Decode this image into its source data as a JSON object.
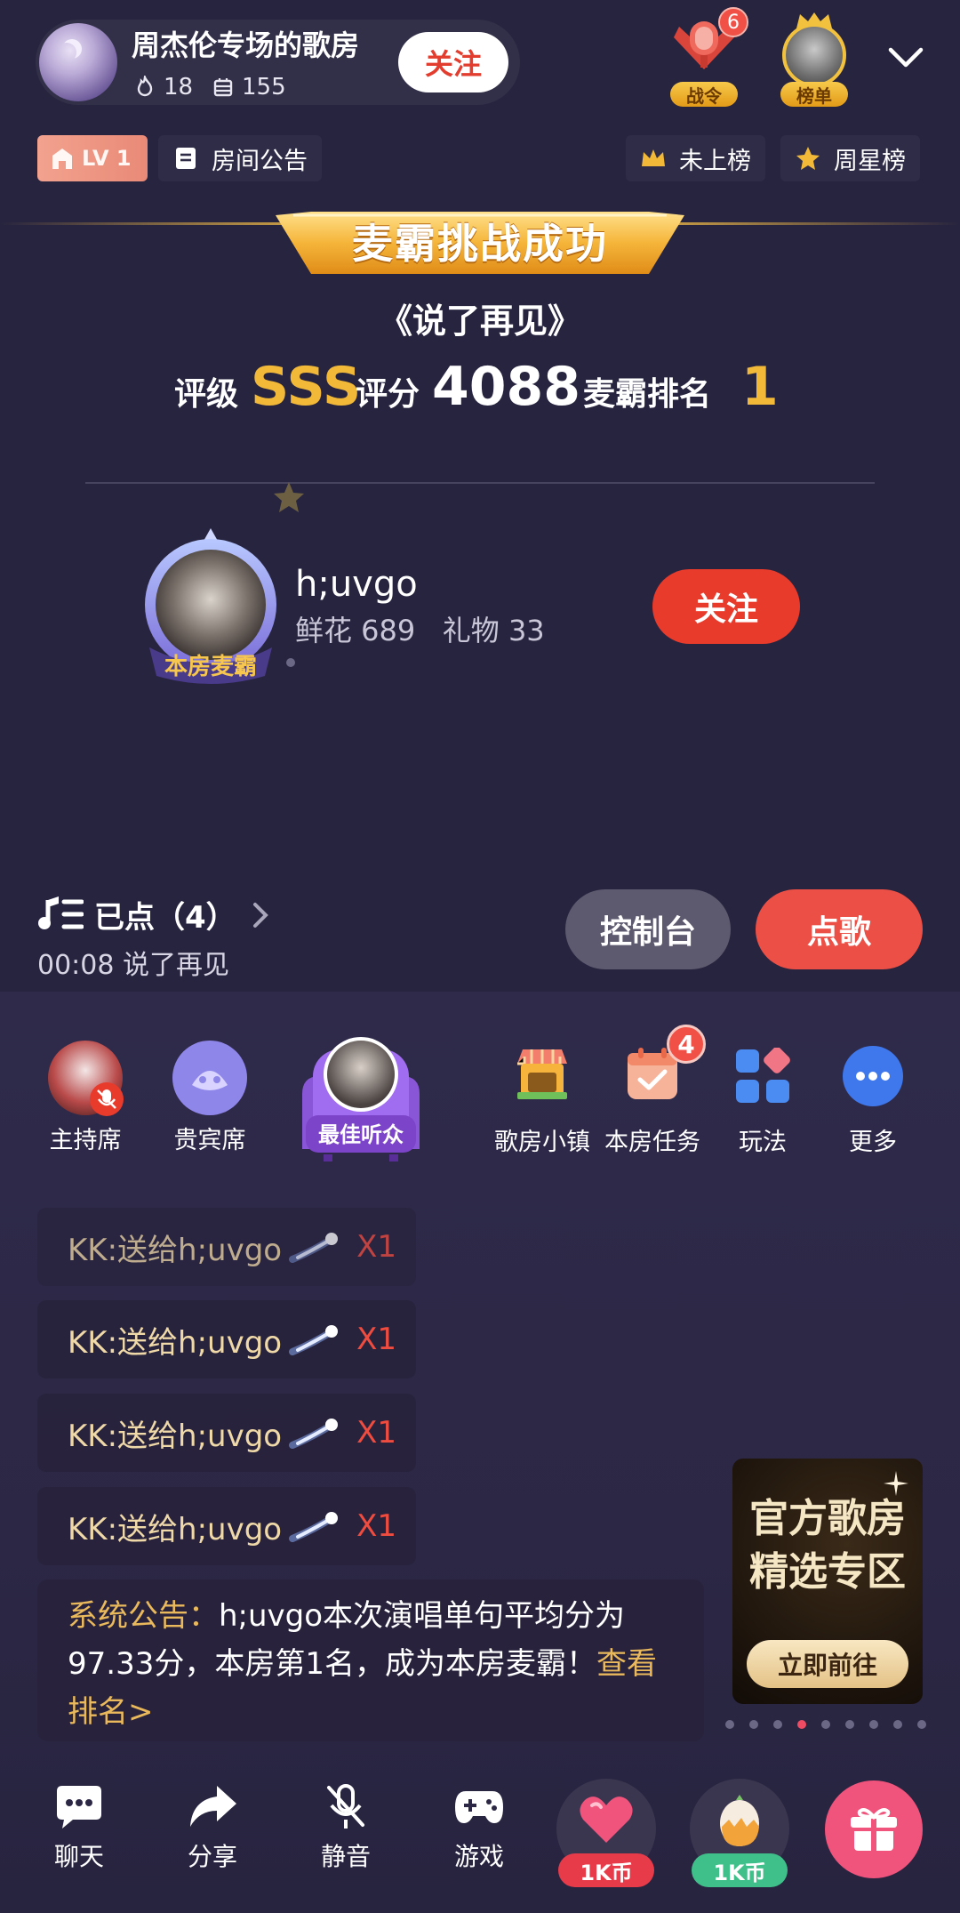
{
  "header": {
    "room_title": "周杰伦专场的歌房",
    "hot_count": "18",
    "member_count": "155",
    "follow_label": "关注",
    "zhanling_label": "战令",
    "zhanling_badge": "6",
    "rank_label": "榜单"
  },
  "room_bar": {
    "level": "LV 1",
    "announcement": "房间公告",
    "not_ranked": "未上榜",
    "weekly_star": "周星榜"
  },
  "challenge": {
    "banner": "麦霸挑战成功",
    "song": "《说了再见》",
    "grade_label": "评级",
    "grade": "SSS",
    "score_label": "评分",
    "score": "4088",
    "rank_label": "麦霸排名",
    "rank": "1",
    "winner_name": "h;uvgo",
    "winner_stats": "鲜花 689   礼物 33",
    "winner_title": "本房麦霸",
    "follow_label": "关注"
  },
  "queue": {
    "label": "已点（4）",
    "now_playing": "00:08 说了再见",
    "console": "控制台",
    "order": "点歌"
  },
  "seats": {
    "host": "主持席",
    "guest": "贵宾席",
    "best_listener": "最佳听众",
    "town": "歌房小镇",
    "tasks": "本房任务",
    "tasks_badge": "4",
    "play": "玩法",
    "more": "更多"
  },
  "chat": {
    "gift_messages": [
      {
        "text": "KK:送给h;uvgo",
        "count": "X1"
      },
      {
        "text": "KK:送给h;uvgo",
        "count": "X1"
      },
      {
        "text": "KK:送给h;uvgo",
        "count": "X1"
      },
      {
        "text": "KK:送给h;uvgo",
        "count": "X1"
      }
    ],
    "system_prefix": "系统公告：",
    "system_text": "h;uvgo本次演唱单句平均分为97.33分，本房第1名，成为本房麦霸！",
    "system_link": "查看排名>"
  },
  "promo": {
    "line1": "官方歌房",
    "line2": "精选专区",
    "button": "立即前往"
  },
  "bottom_bar": {
    "chat": "聊天",
    "share": "分享",
    "mute": "静音",
    "game": "游戏",
    "coin1": "1K币",
    "coin2": "1K币"
  },
  "colors": {
    "background": "#27243f",
    "accent_red": "#e83b2c",
    "gold": "#f2b938",
    "promo_pink": "#f0537b"
  }
}
